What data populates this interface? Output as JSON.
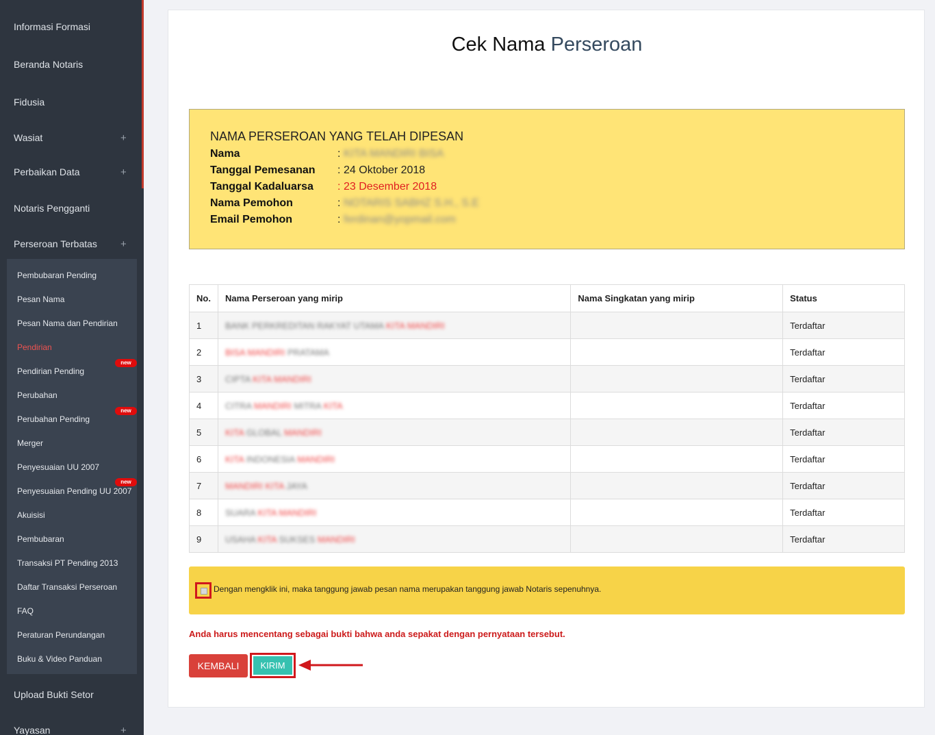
{
  "sidebar": {
    "items": [
      {
        "label": "Informasi Formasi"
      },
      {
        "label": "Beranda Notaris"
      },
      {
        "label": "Fidusia"
      },
      {
        "label": "Wasiat",
        "expand": "+"
      },
      {
        "label": "Perbaikan Data",
        "expand": "+"
      },
      {
        "label": "Notaris Pengganti"
      },
      {
        "label": "Perseroan Terbatas",
        "expand": "+"
      }
    ],
    "sub_items": [
      {
        "label": "Pembubaran Pending"
      },
      {
        "label": "Pesan Nama"
      },
      {
        "label": "Pesan Nama dan Pendirian"
      },
      {
        "label": "Pendirian",
        "active": true
      },
      {
        "label": "Pendirian Pending",
        "badge": "new"
      },
      {
        "label": "Perubahan"
      },
      {
        "label": "Perubahan Pending",
        "badge": "new"
      },
      {
        "label": "Merger"
      },
      {
        "label": "Penyesuaian UU 2007"
      },
      {
        "label": "Penyesuaian Pending UU 2007",
        "badge": "new"
      },
      {
        "label": "Akuisisi"
      },
      {
        "label": "Pembubaran"
      },
      {
        "label": "Transaksi PT Pending 2013"
      },
      {
        "label": "Daftar Transaksi Perseroan"
      },
      {
        "label": "FAQ"
      },
      {
        "label": "Peraturan Perundangan"
      },
      {
        "label": "Buku & Video Panduan"
      }
    ],
    "bottom_items": [
      {
        "label": "Upload Bukti Setor"
      },
      {
        "label": "Yayasan",
        "expand": "+"
      }
    ]
  },
  "page": {
    "title_part1": "Cek Nama",
    "title_part2": "Perseroan"
  },
  "info": {
    "heading": "NAMA PERSEROAN YANG TELAH DIPESAN",
    "rows": [
      {
        "label": "Nama",
        "colon": ":",
        "value": "KITA MANDIRI BISA"
      },
      {
        "label": "Tanggal Pemesanan",
        "colon": ":",
        "value": "24 Oktober 2018"
      },
      {
        "label": "Tanggal Kadaluarsa",
        "colon": ":",
        "value": "23 Desember 2018"
      },
      {
        "label": "Nama Pemohon",
        "colon": ":",
        "value": "NOTARIS SABHZ S.H., S.E"
      },
      {
        "label": "Email Pemohon",
        "colon": ":",
        "value": "ferdinan@yopmail.com"
      }
    ]
  },
  "table": {
    "headers": [
      "No.",
      "Nama Perseroan yang mirip",
      "Nama Singkatan yang mirip",
      "Status"
    ],
    "rows": [
      {
        "no": "1",
        "name": [
          {
            "t": "BANK PERKREDITAN RAKYAT UTAMA ",
            "c": "g"
          },
          {
            "t": "KITA MANDIRI",
            "c": "r"
          }
        ],
        "short": "",
        "status": "Terdaftar"
      },
      {
        "no": "2",
        "name": [
          {
            "t": "BISA MANDIRI ",
            "c": "r"
          },
          {
            "t": "PRATAMA",
            "c": "g"
          }
        ],
        "short": "",
        "status": "Terdaftar"
      },
      {
        "no": "3",
        "name": [
          {
            "t": "CIPTA ",
            "c": "g"
          },
          {
            "t": "KITA MANDIRI",
            "c": "r"
          }
        ],
        "short": "",
        "status": "Terdaftar"
      },
      {
        "no": "4",
        "name": [
          {
            "t": "CITRA ",
            "c": "g"
          },
          {
            "t": "MANDIRI ",
            "c": "r"
          },
          {
            "t": "MITRA ",
            "c": "g"
          },
          {
            "t": "KITA",
            "c": "r"
          }
        ],
        "short": "",
        "status": "Terdaftar"
      },
      {
        "no": "5",
        "name": [
          {
            "t": "KITA ",
            "c": "r"
          },
          {
            "t": "GLOBAL ",
            "c": "g"
          },
          {
            "t": "MANDIRI",
            "c": "r"
          }
        ],
        "short": "",
        "status": "Terdaftar"
      },
      {
        "no": "6",
        "name": [
          {
            "t": "KITA ",
            "c": "r"
          },
          {
            "t": "INDONESIA ",
            "c": "g"
          },
          {
            "t": "MANDIRI",
            "c": "r"
          }
        ],
        "short": "",
        "status": "Terdaftar"
      },
      {
        "no": "7",
        "name": [
          {
            "t": "MANDIRI KITA ",
            "c": "r"
          },
          {
            "t": "JAYA",
            "c": "g"
          }
        ],
        "short": "",
        "status": "Terdaftar"
      },
      {
        "no": "8",
        "name": [
          {
            "t": "SUARA ",
            "c": "g"
          },
          {
            "t": "KITA MANDIRI",
            "c": "r"
          }
        ],
        "short": "",
        "status": "Terdaftar"
      },
      {
        "no": "9",
        "name": [
          {
            "t": "USAHA ",
            "c": "g"
          },
          {
            "t": "KITA ",
            "c": "r"
          },
          {
            "t": "SUKSES ",
            "c": "g"
          },
          {
            "t": "MANDIRI",
            "c": "r"
          }
        ],
        "short": "",
        "status": "Terdaftar"
      }
    ]
  },
  "agreement": {
    "text": "Dengan mengklik ini, maka tanggung jawab pesan nama merupakan tanggung jawab Notaris sepenuhnya.",
    "checked": false
  },
  "warning": "Anda harus mencentang sebagai bukti bahwa anda sepakat dengan pernyataan tersebut.",
  "buttons": {
    "back": "KEMBALI",
    "send": "KIRIM"
  },
  "colors": {
    "sidebar_bg": "#2e353f",
    "info_bg": "#ffe476",
    "agree_bg": "#f7d348",
    "back_btn": "#d9413a",
    "send_btn": "#36c1b0",
    "highlight": "#d0181c"
  }
}
